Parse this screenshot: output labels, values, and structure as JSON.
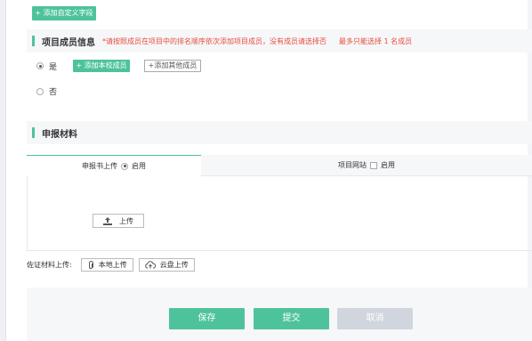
{
  "top_button": {
    "label": "+ 添加自定义字段"
  },
  "members_section": {
    "title": "项目成员信息",
    "hint": "*请按照成员在项目中的排名顺序依次添加项目成员，没有成员请选择否",
    "limit": "最多只能选择 1 名成员",
    "yes_label": "是",
    "no_label": "否",
    "yes_selected": true,
    "add_school_member": "+ 添加本校成员",
    "add_other_member": "+添加其他成员"
  },
  "materials_section": {
    "title": "申报材料",
    "tabs": [
      {
        "label": "申报书上传",
        "option": "启用",
        "enabled": true
      },
      {
        "label": "项目网站",
        "option": "启用",
        "enabled": false
      }
    ],
    "upload_label": "上传"
  },
  "evidence": {
    "label": "佐证材料上传:",
    "local_upload": "本地上传",
    "cloud_upload": "云盘上传"
  },
  "footer": {
    "save": "保存",
    "submit": "提交",
    "cancel": "取消"
  },
  "colors": {
    "accent": "#4ec39b",
    "hint_red": "#e84c3d",
    "cancel_gray": "#d1d5dd"
  }
}
